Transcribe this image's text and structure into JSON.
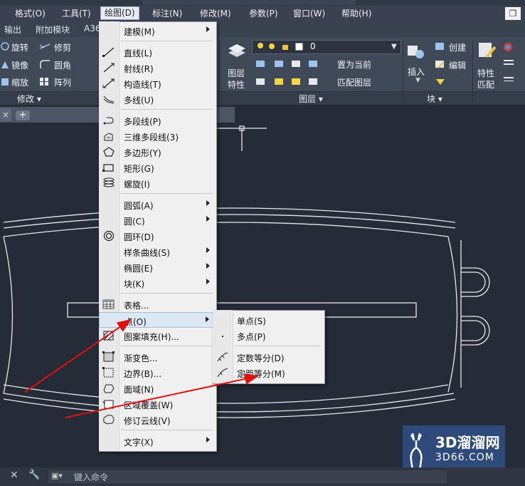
{
  "menubar": {
    "items": [
      {
        "label": "格式(O)"
      },
      {
        "label": "工具(T)"
      },
      {
        "label": "绘图(D)"
      },
      {
        "label": "标注(N)"
      },
      {
        "label": "修改(M)"
      },
      {
        "label": "参数(P)"
      },
      {
        "label": "窗口(W)"
      },
      {
        "label": "帮助(H)"
      }
    ],
    "active_item": "绘图(D)"
  },
  "ribbon_tabs": [
    "输出",
    "附加模块",
    "A36"
  ],
  "ribbon": {
    "modify": {
      "buttons": [
        "旋转",
        "修剪",
        "镜像",
        "圆角",
        "缩放",
        "阵列"
      ],
      "title": "修改"
    },
    "layers": {
      "current_layer": "0",
      "buttons": [
        "置为当前",
        "匹配图层"
      ],
      "layer_props_label": [
        "图层",
        "特性"
      ],
      "title": "图层"
    },
    "block": {
      "insert_label": "插入",
      "buttons": [
        "创建",
        "编辑"
      ],
      "title": "块"
    },
    "properties": {
      "match_label": [
        "特性",
        "匹配"
      ]
    }
  },
  "draw_menu": {
    "items": [
      {
        "label": "建模(M)",
        "icon": "none",
        "submenu": true
      },
      {
        "label": "直线(L)",
        "icon": "line-icon"
      },
      {
        "label": "射线(R)",
        "icon": "ray-icon"
      },
      {
        "label": "构造线(T)",
        "icon": "xline-icon"
      },
      {
        "label": "多线(U)",
        "icon": "mline-icon"
      },
      {
        "label": "多段线(P)",
        "icon": "polyline-icon"
      },
      {
        "label": "三维多段线(3)",
        "icon": "3dpoly-icon"
      },
      {
        "label": "多边形(Y)",
        "icon": "polygon-icon"
      },
      {
        "label": "矩形(G)",
        "icon": "rectangle-icon"
      },
      {
        "label": "螺旋(I)",
        "icon": "helix-icon"
      },
      {
        "label": "圆弧(A)",
        "icon": "none",
        "submenu": true
      },
      {
        "label": "圆(C)",
        "icon": "none",
        "submenu": true
      },
      {
        "label": "圆环(D)",
        "icon": "donut-icon"
      },
      {
        "label": "样条曲线(S)",
        "icon": "none",
        "submenu": true
      },
      {
        "label": "椭圆(E)",
        "icon": "none",
        "submenu": true
      },
      {
        "label": "块(K)",
        "icon": "none",
        "submenu": true
      },
      {
        "label": "表格...",
        "icon": "table-icon"
      },
      {
        "label": "点(O)",
        "icon": "none",
        "submenu": true,
        "highlighted": true
      },
      {
        "label": "图案填充(H)...",
        "icon": "hatch-icon"
      },
      {
        "label": "渐变色...",
        "icon": "gradient-icon"
      },
      {
        "label": "边界(B)...",
        "icon": "boundary-icon"
      },
      {
        "label": "面域(N)",
        "icon": "region-icon"
      },
      {
        "label": "区域覆盖(W)",
        "icon": "wipeout-icon"
      },
      {
        "label": "修订云线(V)",
        "icon": "revcloud-icon"
      },
      {
        "label": "文字(X)",
        "icon": "none",
        "submenu": true
      }
    ]
  },
  "point_submenu": {
    "items": [
      {
        "label": "单点(S)",
        "icon": "none"
      },
      {
        "label": "多点(P)",
        "icon": "multipoint-icon"
      },
      {
        "label": "定数等分(D)",
        "icon": "divide-icon"
      },
      {
        "label": "定距等分(M)",
        "icon": "measure-icon"
      }
    ]
  },
  "command_line": {
    "placeholder": "键入命令"
  },
  "doc_tabs": {
    "close": "×",
    "add": "+"
  },
  "window_control": "❐",
  "watermark": {
    "logo": "3D溜溜网",
    "url": "3D66.COM"
  },
  "colors": {
    "canvas": "#252c37",
    "arrow": "#e01010",
    "geometry": "#e8e8e8",
    "menu_bg": "#f0f0f0",
    "watermark_bg": "#2e4a7a"
  }
}
